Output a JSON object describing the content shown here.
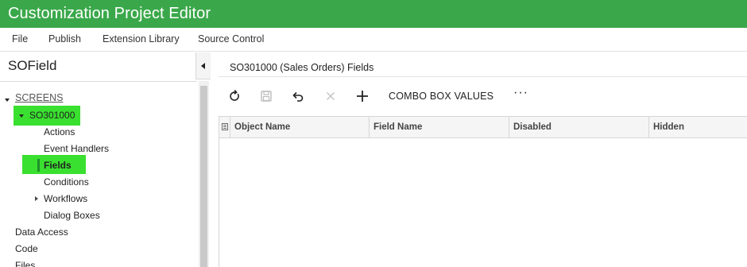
{
  "app": {
    "title": "Customization Project Editor"
  },
  "menu": [
    "File",
    "Publish",
    "Extension Library",
    "Source Control"
  ],
  "project": {
    "name": "SOField"
  },
  "tree": {
    "screens": "SCREENS",
    "screen": "SO301000",
    "children": [
      "Actions",
      "Event Handlers",
      "Fields",
      "Conditions",
      "Workflows",
      "Dialog Boxes"
    ],
    "after": [
      "Data Access",
      "Code",
      "Files"
    ]
  },
  "panel": {
    "title": "SO301000 (Sales Orders) Fields",
    "toolbar": {
      "refresh": "refresh-icon",
      "save": "save-icon",
      "undo": "undo-icon",
      "delete": "close-icon",
      "add": "plus-icon",
      "combo_label": "COMBO BOX VALUES",
      "more": "···"
    },
    "columns": [
      "Object Name",
      "Field Name",
      "Disabled",
      "Hidden"
    ]
  },
  "colors": {
    "header": "#3aa84a",
    "highlight": "#39e02f"
  }
}
